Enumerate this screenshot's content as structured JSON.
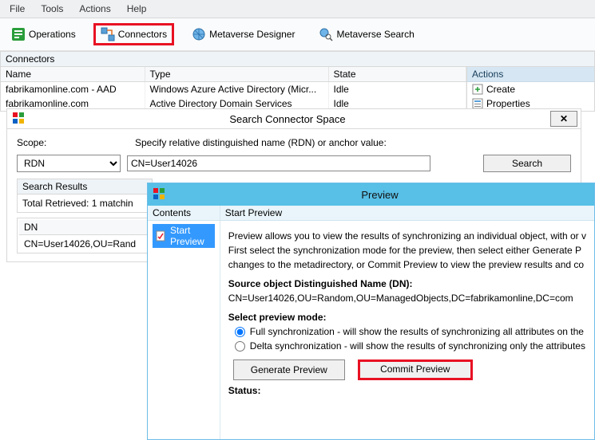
{
  "menu": {
    "items": [
      "File",
      "Tools",
      "Actions",
      "Help"
    ]
  },
  "toolbar": {
    "operations": "Operations",
    "connectors": "Connectors",
    "mv_designer": "Metaverse Designer",
    "mv_search": "Metaverse Search"
  },
  "section": {
    "connectors_label": "Connectors"
  },
  "connectors_table": {
    "headers": [
      "Name",
      "Type",
      "State"
    ],
    "rows": [
      {
        "name": "fabrikamonline.com - AAD",
        "type": "Windows Azure Active Directory (Micr...",
        "state": "Idle"
      },
      {
        "name": "fabrikamonline.com",
        "type": "Active Directory Domain Services",
        "state": "Idle"
      }
    ]
  },
  "actions_pane": {
    "header": "Actions",
    "items": [
      "Create",
      "Properties"
    ]
  },
  "scs": {
    "title": "Search Connector Space",
    "scope_label": "Scope:",
    "instruction": "Specify relative distinguished name (RDN) or anchor value:",
    "scope_value": "RDN",
    "rdn_value": "CN=User14026",
    "search_btn": "Search",
    "results_header": "Search Results",
    "total_retrieved": "Total Retrieved: 1 matchin",
    "dn_header": "DN",
    "dn_row": "CN=User14026,OU=Rand"
  },
  "preview": {
    "title": "Preview",
    "tree_header": "Contents",
    "tree_node": "Start Preview",
    "start_header": "Start Preview",
    "intro": "Preview allows you to view the results of synchronizing an individual object, with or v",
    "para2a": "First select the synchronization  mode for the preview, then select either Generate P",
    "para2b": "changes to the metadirectory, or Commit Preview to view the preview results and co",
    "dn_label": "Source object Distinguished Name (DN):",
    "dn_value": "CN=User14026,OU=Random,OU=ManagedObjects,DC=fabrikamonline,DC=com",
    "mode_label": "Select preview mode:",
    "radio_full": "Full synchronization - will show the results of synchronizing all attributes on the",
    "radio_delta": "Delta synchronization - will show the results of synchronizing only the attributes",
    "gen_btn": "Generate Preview",
    "commit_btn": "Commit Preview",
    "status_label": "Status:"
  }
}
